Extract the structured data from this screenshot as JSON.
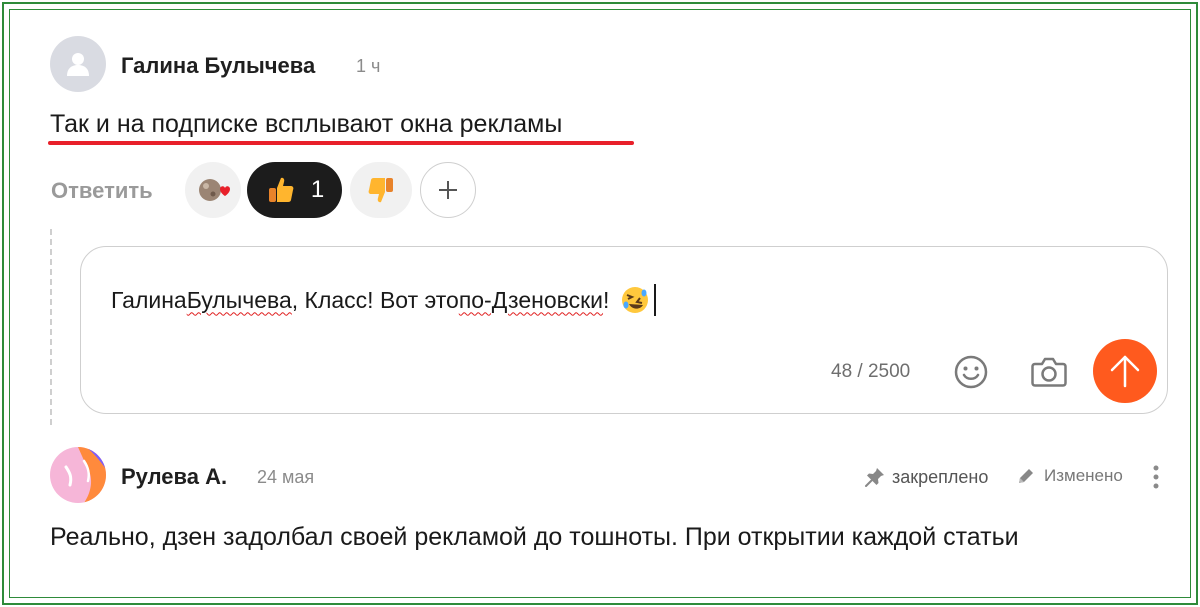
{
  "comment1": {
    "author": "Галина Булычева",
    "time": "1 ч",
    "text": "Так и на подписке всплывают окна рекламы",
    "reply_label": "Ответить",
    "reactions": [
      {
        "icon": "planet-heart-icon"
      },
      {
        "icon": "thumbs-up-icon",
        "count": "1",
        "active": true
      },
      {
        "icon": "thumbs-down-icon"
      },
      {
        "icon": "plus-icon"
      }
    ]
  },
  "reply_editor": {
    "mention": "Галина Булычева",
    "text_parts": [
      "Галина ",
      "Булычева",
      ", Класс! Вот это ",
      "по-Дзеновски",
      "! "
    ],
    "emoji_icon": "rolling-laughing-face-icon",
    "counter": "48 / 2500",
    "send_color": "#ff5a1e"
  },
  "comment2": {
    "author": "Рулева А.",
    "time": "24 мая",
    "pinned_label": "закреплено",
    "edited_label": "Изменено",
    "text": "Реально, дзен задолбал своей рекламой до тошноты. При открытии каждой статьи"
  },
  "colors": {
    "accent": "#ff5a1e",
    "frame": "#2e8b3a",
    "highlight_underline": "#e8202a"
  }
}
